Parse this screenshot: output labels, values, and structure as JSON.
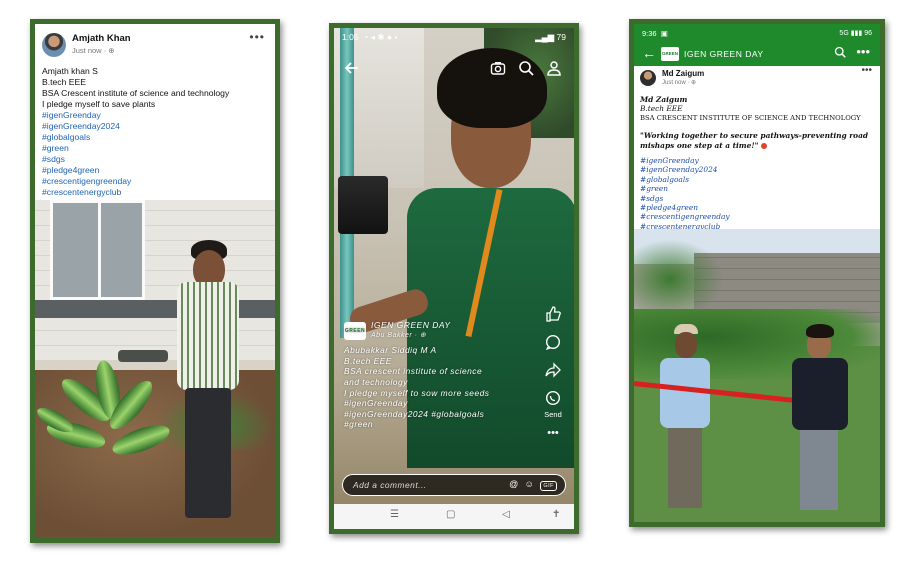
{
  "panel1": {
    "author": "Amjath Khan",
    "time": "Just now",
    "more": "•••",
    "lines": [
      "Amjath khan S",
      "B.tech EEE",
      "BSA Crescent institute of science and technology",
      "I pledge myself to save plants"
    ],
    "hashtags": [
      "#igenGreenday",
      "#igenGreenday2024",
      "#globalgoals",
      "#green",
      "#sdgs",
      "#pledge4green",
      "#crescentigengreenday",
      "#crescentenergyclub"
    ]
  },
  "panel2": {
    "clock": "1:05",
    "battery": "79",
    "brand_name": "IGEN GREEN DAY",
    "brand_sub": "Abu Bakker",
    "logo_text": "GREEN",
    "caption_lines": [
      "Abubakkar Siddiq M A",
      "B.tech EEE",
      "BSA crescent institute of science",
      "and technology",
      "I pledge myself to sow more seeds",
      "#igenGreenday",
      "#igenGreenday2024 #globalgoals",
      "#green"
    ],
    "send_label": "Send",
    "comment_placeholder": "Add a comment...",
    "gif_label": "GIF"
  },
  "panel3": {
    "clock": "9:36",
    "status_right": "5G ▮▮▮ 96",
    "title": "IGEN GREEN DAY",
    "logo_text": "GREEN",
    "author": "Md Zaigum",
    "time": "Just now",
    "lines": [
      "Md Zaigum",
      "B.tech EEE",
      "BSA CRESCENT INSTITUTE OF SCIENCE AND TECHNOLOGY"
    ],
    "quote": "\"Working together to secure pathways-preventing road mishaps one step at a time!\"",
    "hashtags": [
      "#igenGreenday",
      "#igenGreenday2024",
      "#globalgoals",
      "#green",
      "#sdgs",
      "#pledge4green",
      "#crescentigengreenday",
      "#crescentenergyclub"
    ]
  },
  "colors": {
    "frame": "#3d6b2b",
    "group_header": "#1f8a2c",
    "hashtag": "#1f64b5"
  }
}
